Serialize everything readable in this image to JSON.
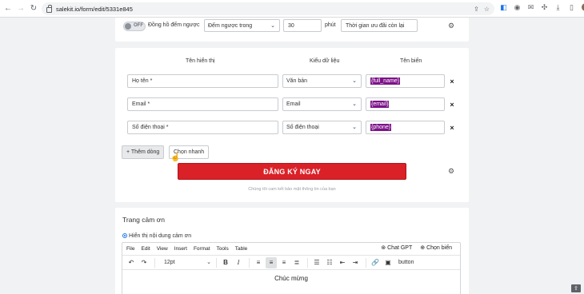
{
  "browser": {
    "url": "salekit.io/form/edit/5331e845"
  },
  "countdown": {
    "toggle_state": "OFF",
    "label": "Đồng hồ đếm ngược",
    "mode_value": "Đếm ngược trong",
    "minutes_value": "30",
    "unit_label": "phút",
    "message_value": "Thời gian ưu đãi còn lại"
  },
  "fields_table": {
    "headers": [
      "Tên hiển thị",
      "Kiểu dữ liệu",
      "Tên biến"
    ],
    "rows": [
      {
        "display_name": "Họ tên *",
        "data_type": "Văn bản",
        "variable": "{full_name}"
      },
      {
        "display_name": "Email *",
        "data_type": "Email",
        "variable": "{email}"
      },
      {
        "display_name": "Số điện thoại *",
        "data_type": "Số điện thoại",
        "variable": "{phone}"
      }
    ],
    "add_row_label": "+ Thêm dòng",
    "quick_pick_label": "Chọn nhanh"
  },
  "cta": {
    "label": "ĐĂNG KÝ NGAY",
    "note": "Chúng tôi cam kết bảo mật thông tin của bạn"
  },
  "thank_you": {
    "title": "Trang cảm ơn",
    "radio_label": "Hiển thị nội dung cảm ơn",
    "menu": [
      "File",
      "Edit",
      "View",
      "Insert",
      "Format",
      "Tools",
      "Table"
    ],
    "chat_gpt_label": "Chat GPT",
    "choose_var_label": "Chọn biến",
    "font_size_value": "12pt",
    "button_label": "button",
    "content": "Chúc mừng"
  },
  "colors": {
    "cta_red": "#da2128",
    "variable_highlight": "#7d1389",
    "card_bg": "#ffffff",
    "page_bg": "#f1f2f4"
  }
}
